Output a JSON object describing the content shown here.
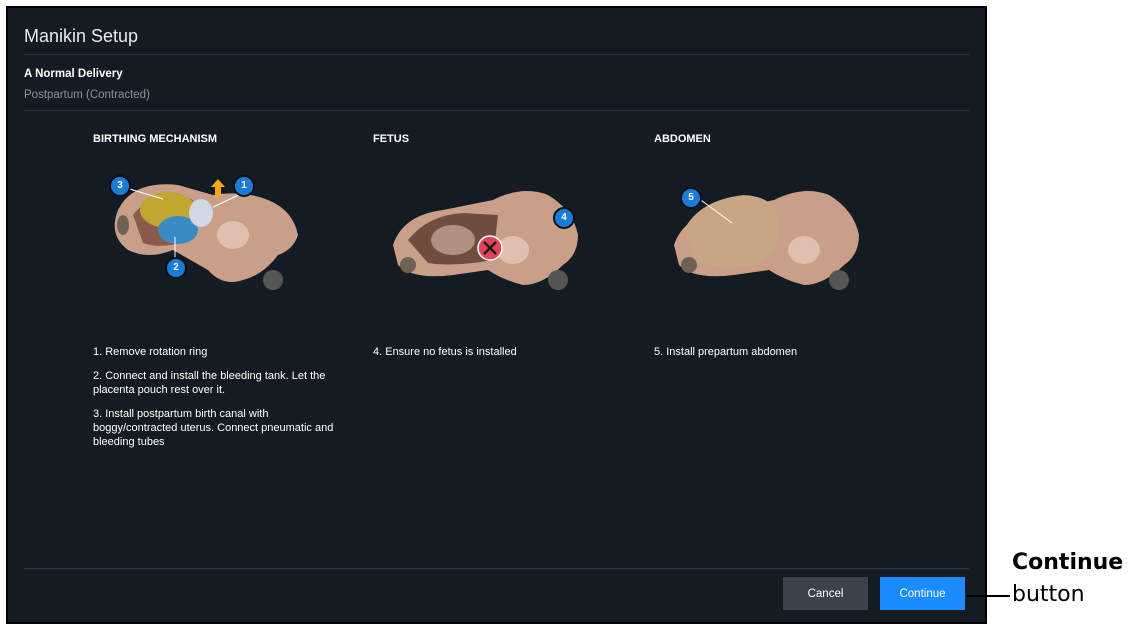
{
  "dialog": {
    "title": "Manikin Setup",
    "scenario_name": "A Normal Delivery",
    "scenario_state": "Postpartum (Contracted)"
  },
  "columns": [
    {
      "title": "BIRTHING MECHANISM",
      "steps": [
        "1. Remove rotation ring",
        "2. Connect and install the bleeding tank. Let the placenta pouch rest over it.",
        "3. Install postpartum birth canal with boggy/contracted uterus. Connect pneumatic and bleeding tubes"
      ],
      "badges": [
        "1",
        "2",
        "3"
      ]
    },
    {
      "title": "FETUS",
      "steps": [
        "4. Ensure no fetus is installed"
      ],
      "badges": [
        "4"
      ]
    },
    {
      "title": "ABDOMEN",
      "steps": [
        "5. Install prepartum abdomen"
      ],
      "badges": [
        "5"
      ]
    }
  ],
  "footer": {
    "cancel_label": "Cancel",
    "continue_label": "Continue"
  },
  "callout": {
    "title": "Continue",
    "subtitle": "button"
  },
  "colors": {
    "background": "#151b22",
    "primary": "#1a8cff",
    "secondary_button": "#3a424c",
    "badge": "#1b7bd8",
    "no_icon": "#e0435a",
    "arrow": "#f5a623"
  },
  "icons": {
    "step_badge": "numbered-circle",
    "no_fetus": "x-circle-icon",
    "direction": "arrow-up-icon"
  }
}
